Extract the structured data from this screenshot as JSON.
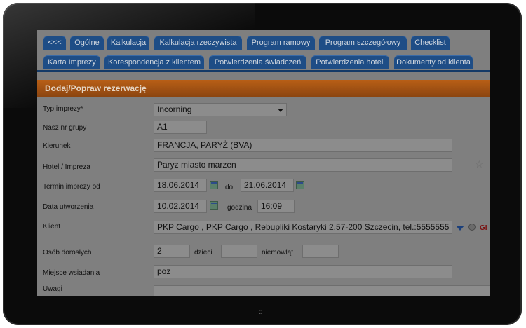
{
  "tabs_row1": [
    {
      "label": "<<<"
    },
    {
      "label": "Ogólne"
    },
    {
      "label": "Kalkulacja"
    },
    {
      "label": "Kalkulacja rzeczywista"
    },
    {
      "label": "Program ramowy"
    },
    {
      "label": "Program szczegółowy"
    },
    {
      "label": "Checklist"
    }
  ],
  "tabs_row2": [
    {
      "label": "Karta Imprezy"
    },
    {
      "label": "Korespondencja z klientem"
    },
    {
      "label": "Potwierdzenia świadczeń"
    },
    {
      "label": "Potwierdzenia hoteli"
    },
    {
      "label": "Dokumenty od klienta"
    }
  ],
  "header": {
    "title": "Dodaj/Popraw rezerwację"
  },
  "form": {
    "typ_imprezy": {
      "label": "Typ imprezy*",
      "value": "Incorning"
    },
    "nasz_nr_grupy": {
      "label": "Nasz nr grupy",
      "value": "A1"
    },
    "kierunek": {
      "label": "Kierunek",
      "value": "FRANCJA, PARYŻ (BVA)"
    },
    "hotel": {
      "label": "Hotel / Impreza",
      "value": "Paryz miasto marzen"
    },
    "termin": {
      "label": "Termin imprezy od",
      "from": "18.06.2014",
      "do_label": "do",
      "to": "21.06.2014"
    },
    "data_utworzenia": {
      "label": "Data utworzenia",
      "value": "10.02.2014",
      "godzina_label": "godzina",
      "godzina": "16:09"
    },
    "klient": {
      "label": "Klient",
      "value": "PKP Cargo , PKP Cargo , Rebupliki Kostaryki 2,57-200 Szczecin, tel.:5555555",
      "extra": "GI"
    },
    "osoby": {
      "label": "Osób dorosłych",
      "dorosli": "2",
      "dzieci_label": "dzieci",
      "dzieci": "",
      "niemowlat_label": "niemowląt",
      "niemowlat": ""
    },
    "miejsce": {
      "label": "Miejsce wsiadania",
      "value": "poz"
    },
    "uwagi": {
      "label": "Uwagi",
      "value": ""
    }
  },
  "home_button": "::"
}
